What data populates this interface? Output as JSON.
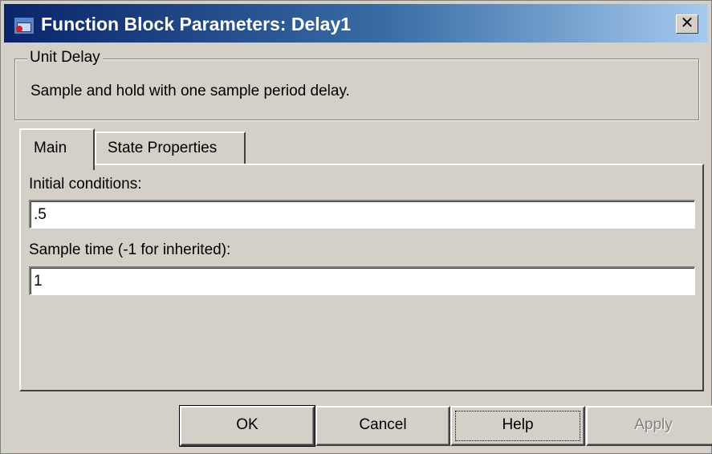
{
  "window": {
    "title": "Function Block Parameters: Delay1",
    "close_label": "✕"
  },
  "block": {
    "name": "Unit Delay",
    "description": "Sample and hold with one sample period delay."
  },
  "tabs": [
    {
      "label": "Main",
      "selected": true
    },
    {
      "label": "State Properties",
      "selected": false
    }
  ],
  "parameters": {
    "initial_conditions": {
      "label": "Initial conditions:",
      "value": ".5"
    },
    "sample_time": {
      "label": "Sample time (-1 for inherited):",
      "value": "1"
    }
  },
  "buttons": {
    "ok": "OK",
    "cancel": "Cancel",
    "help": "Help",
    "apply": "Apply",
    "apply_enabled": false
  },
  "colors": {
    "dialog_face": "#d4d0c8",
    "titlebar_start": "#0a246a",
    "titlebar_end": "#a6caf0",
    "disabled_text": "#808080"
  },
  "icons": {
    "app": "simulink-block-icon",
    "close": "close-icon"
  }
}
